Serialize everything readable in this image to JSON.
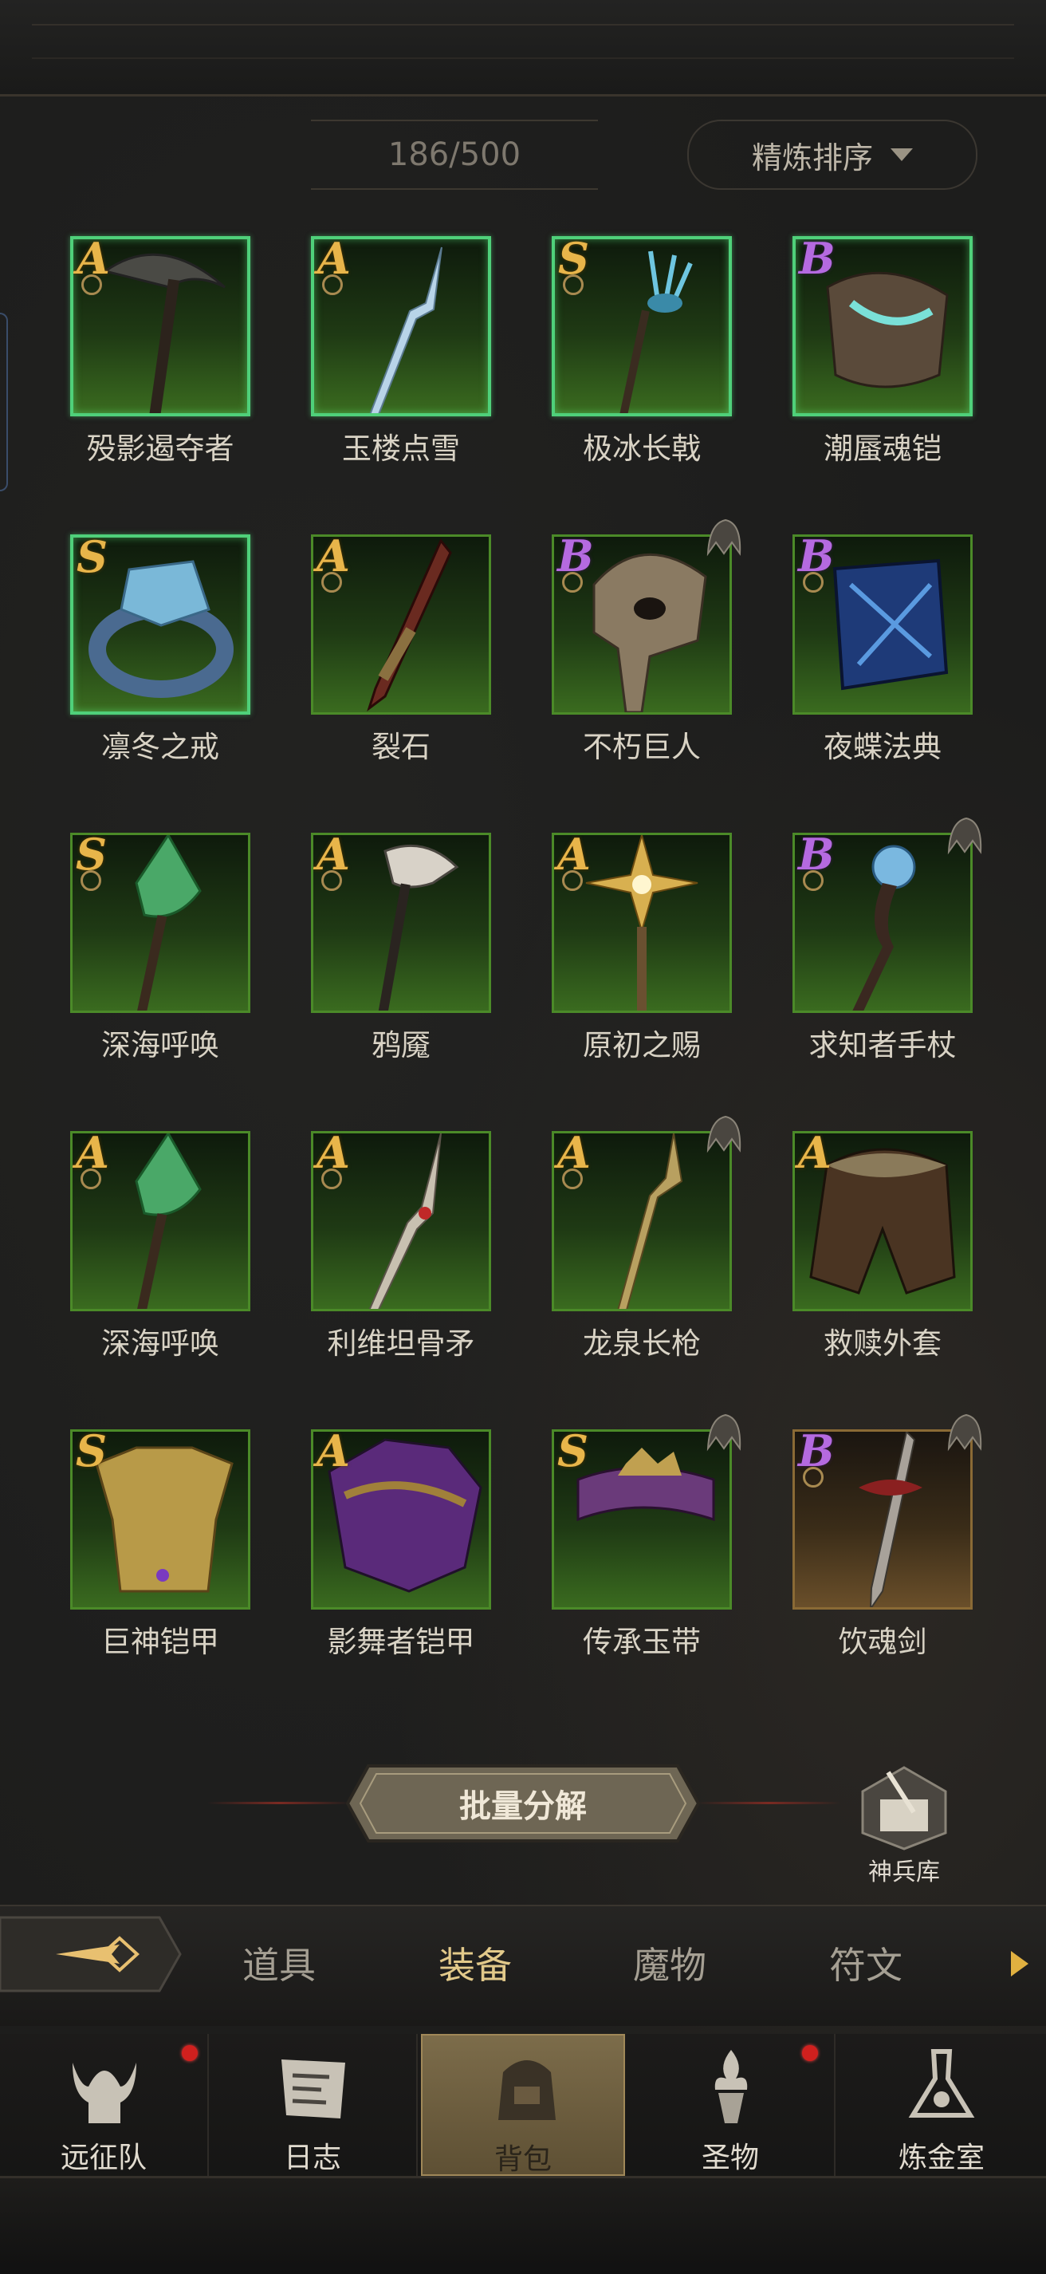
{
  "inventory": {
    "count": "186/500",
    "sort_label": "精炼排序",
    "items": [
      {
        "name": "殁影遏夺者",
        "grade": "A"
      },
      {
        "name": "玉楼点雪",
        "grade": "A"
      },
      {
        "name": "极冰长戟",
        "grade": "S"
      },
      {
        "name": "潮蜃魂铠",
        "grade": "B"
      },
      {
        "name": "凛冬之戒",
        "grade": "S"
      },
      {
        "name": "裂石",
        "grade": "A"
      },
      {
        "name": "不朽巨人",
        "grade": "B"
      },
      {
        "name": "夜蝶法典",
        "grade": "B"
      },
      {
        "name": "深海呼唤",
        "grade": "S"
      },
      {
        "name": "鸦魇",
        "grade": "A"
      },
      {
        "name": "原初之赐",
        "grade": "A"
      },
      {
        "name": "求知者手杖",
        "grade": "B"
      },
      {
        "name": "深海呼唤",
        "grade": "A"
      },
      {
        "name": "利维坦骨矛",
        "grade": "A"
      },
      {
        "name": "龙泉长枪",
        "grade": "A"
      },
      {
        "name": "救赎外套",
        "grade": "A"
      },
      {
        "name": "巨神铠甲",
        "grade": "S"
      },
      {
        "name": "影舞者铠甲",
        "grade": "A"
      },
      {
        "name": "传承玉带",
        "grade": "S"
      },
      {
        "name": "饮魂剑",
        "grade": "B"
      }
    ]
  },
  "actions": {
    "bulk_decompose": "批量分解",
    "armory": "神兵库"
  },
  "tabs": [
    {
      "label": "道具"
    },
    {
      "label": "装备"
    },
    {
      "label": "魔物"
    },
    {
      "label": "符文"
    }
  ],
  "bottom_nav": [
    {
      "label": "远征队"
    },
    {
      "label": "日志"
    },
    {
      "label": "背包"
    },
    {
      "label": "圣物"
    },
    {
      "label": "炼金室"
    }
  ],
  "colors": {
    "accent_gold": "#e2c98a",
    "grade_gold": "#e8b54a",
    "grade_purple": "#b56ae0",
    "tile_green": "#4b8a28",
    "glow_green": "#4fd07a",
    "notification_red": "#d0201e"
  }
}
